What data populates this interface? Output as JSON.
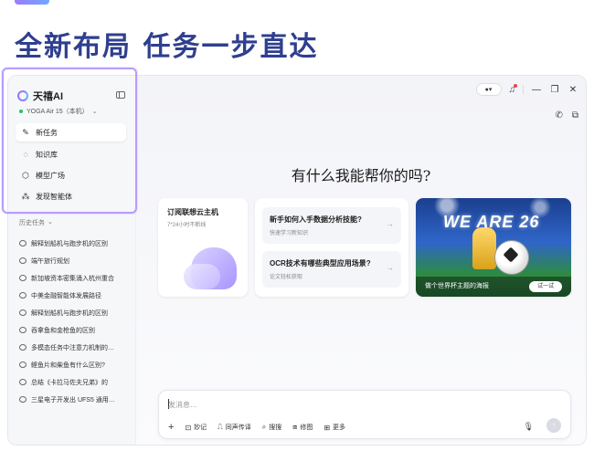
{
  "headline": "全新布局  任务一步直达",
  "colors": {
    "accent": "#2f3f8f",
    "highlight": "#b99cff"
  },
  "sidebar": {
    "brand": "天禧AI",
    "device": "YOGA Air 15（本机）",
    "nav": [
      {
        "label": "新任务",
        "icon": "edit-icon"
      },
      {
        "label": "知识库",
        "icon": "knowledge-icon"
      },
      {
        "label": "模型广场",
        "icon": "cube-icon"
      },
      {
        "label": "发现智能体",
        "icon": "agents-icon"
      }
    ],
    "history_title": "历史任务",
    "history": [
      "解释划船机与跑步机的区别",
      "端午旅行规划",
      "新加坡资本密集涌入杭州重合",
      "中美金融智能体发展路径",
      "解释划船机与跑步机的区别",
      "吞拿鱼和金枪鱼的区别",
      "多模态任务中注意力机制的…",
      "鲣鱼片和柴鱼有什么区别?",
      "总结《卡拉马佐夫兄弟》的",
      "三星电子开发出 UFS5 通用…"
    ]
  },
  "main": {
    "greeting": "有什么我能帮你的吗?",
    "cloud_card": {
      "title": "订阅联想云主机",
      "subtitle": "7*24小时不断线"
    },
    "qa": [
      {
        "title": "新手如何入手数据分析技能?",
        "subtitle": "快速学习新知识"
      },
      {
        "title": "OCR技术有哪些典型应用场景?",
        "subtitle": "论文轻松获取"
      }
    ],
    "promo": {
      "image_text": "WE ARE 26",
      "caption": "做个世界杯主题的海报",
      "button": "试一试"
    },
    "input": {
      "placeholder": "发消息…",
      "actions": [
        "妙记",
        "同声传译",
        "搜搜",
        "修图",
        "更多"
      ]
    }
  }
}
